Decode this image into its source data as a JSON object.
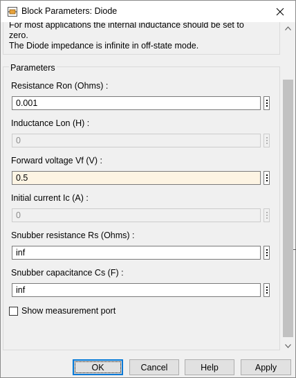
{
  "window": {
    "title": "Block Parameters: Diode"
  },
  "description": {
    "lines": [
      "For most applications the internal inductance should be set to",
      "zero.",
      "The Diode impedance is infinite in off-state mode."
    ]
  },
  "parameters": {
    "legend": "Parameters",
    "fields": [
      {
        "label": "Resistance Ron (Ohms) :",
        "value": "0.001",
        "enabled": true
      },
      {
        "label": "Inductance Lon (H) :",
        "value": "0",
        "enabled": false
      },
      {
        "label": "Forward voltage Vf (V) :",
        "value": "0.5",
        "enabled": true,
        "focused": true
      },
      {
        "label": "Initial current Ic (A) :",
        "value": "0",
        "enabled": false
      },
      {
        "label": "Snubber resistance Rs (Ohms) :",
        "value": "inf",
        "enabled": true
      },
      {
        "label": "Snubber capacitance Cs (F) :",
        "value": "inf",
        "enabled": true
      }
    ],
    "checkbox": {
      "label": "Show measurement port",
      "checked": false
    }
  },
  "buttons": {
    "ok": "OK",
    "cancel": "Cancel",
    "help": "Help",
    "apply": "Apply"
  },
  "colors": {
    "focused_field_bg": "#fdf4e3",
    "default_button_border": "#0078d7",
    "scroll_thumb": "#c1c1c1"
  }
}
